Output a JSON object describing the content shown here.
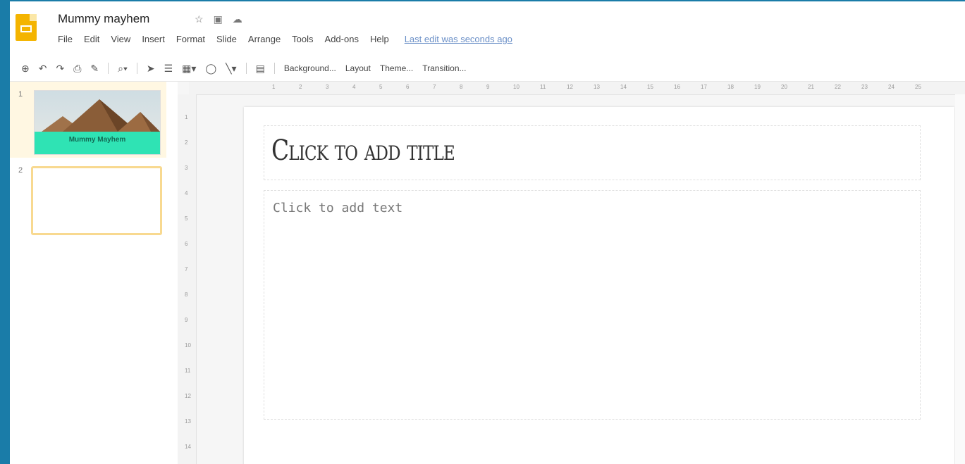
{
  "document": {
    "title": "Mummy mayhem",
    "title_icons": [
      "star-icon",
      "folder-icon",
      "cloud-icon"
    ]
  },
  "menu": [
    "File",
    "Edit",
    "View",
    "Insert",
    "Format",
    "Slide",
    "Arrange",
    "Tools",
    "Add-ons",
    "Help"
  ],
  "last_edit": "Last edit was seconds ago",
  "toolbar": {
    "icons": [
      "new-slide-icon",
      "undo-icon",
      "redo-icon",
      "print-icon",
      "paint-format-icon",
      "zoom-icon",
      "select-icon",
      "textbox-icon",
      "image-icon",
      "shape-icon",
      "line-icon",
      "comment-icon"
    ],
    "background_label": "Background...",
    "layout_label": "Layout",
    "theme_label": "Theme...",
    "transition_label": "Transition..."
  },
  "slides": [
    {
      "number": "1",
      "title": "Mummy Mayhem"
    },
    {
      "number": "2"
    }
  ],
  "current_slide": {
    "title_placeholder": "Click to add title",
    "body_placeholder": "Click to add text"
  },
  "ruler": {
    "horizontal": [
      "1",
      "2",
      "3",
      "4",
      "5",
      "6",
      "7",
      "8",
      "9",
      "10",
      "11",
      "12",
      "13",
      "14",
      "15",
      "16",
      "17",
      "18",
      "19",
      "20",
      "21",
      "22",
      "23",
      "24",
      "25"
    ],
    "vertical": [
      "1",
      "2",
      "3",
      "4",
      "5",
      "6",
      "7",
      "8",
      "9",
      "10",
      "11",
      "12",
      "13",
      "14"
    ]
  },
  "colors": {
    "accent": "#f4b400",
    "title_band": "#2fe3b4",
    "selection": "#f8d990",
    "window_frame": "#1a7ca8"
  }
}
